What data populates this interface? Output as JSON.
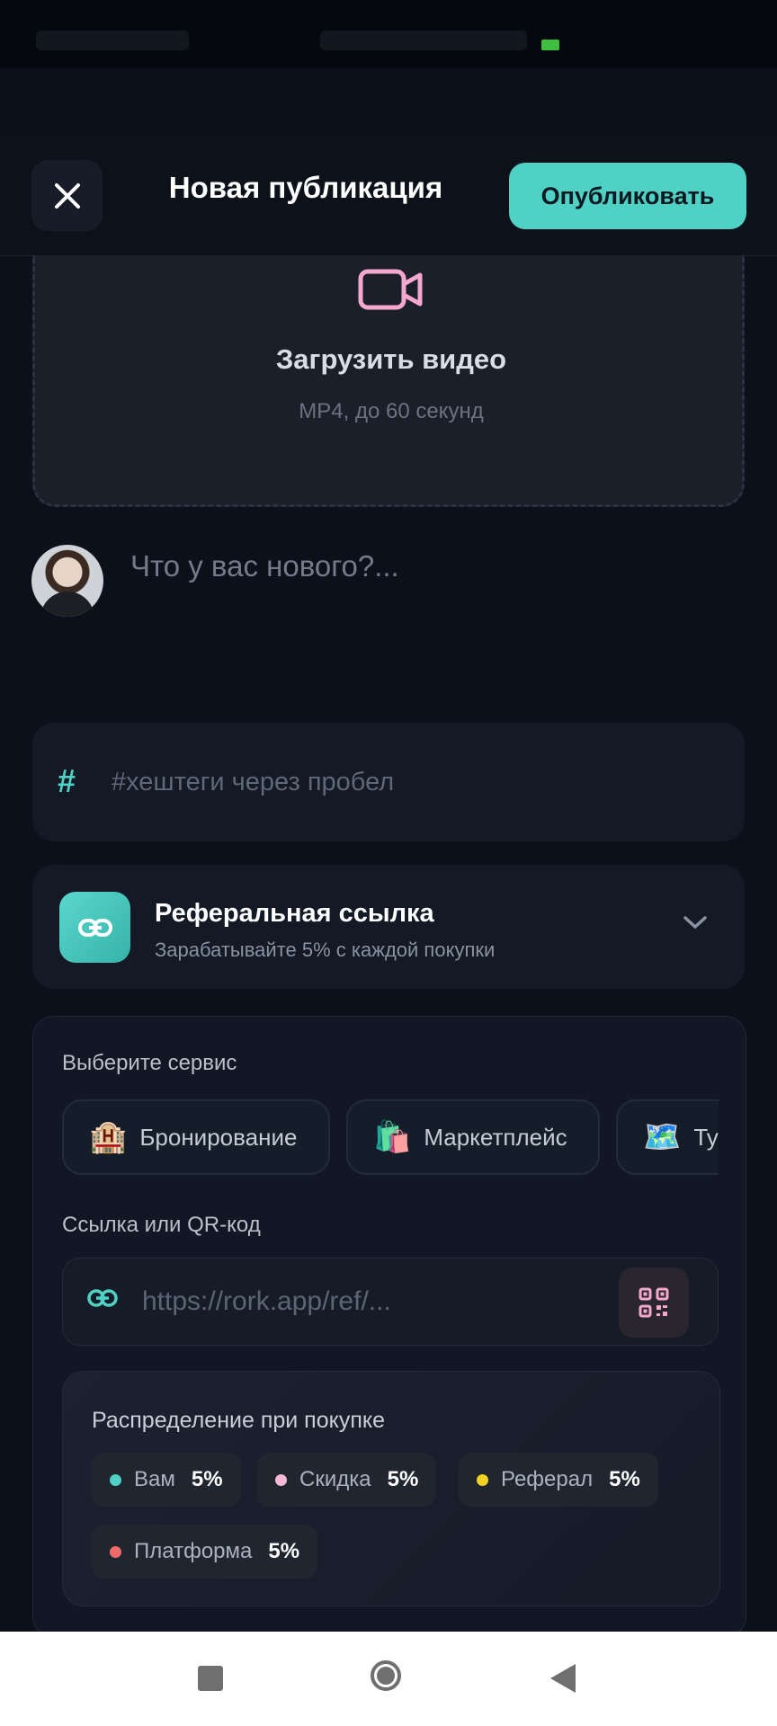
{
  "header": {
    "title": "Новая публикация",
    "publish_label": "Опубликовать",
    "close_icon": "close-icon"
  },
  "upload": {
    "icon": "video-camera-icon",
    "title": "Загрузить видео",
    "subtitle": "MP4, до 60 секунд"
  },
  "post": {
    "placeholder": "Что у вас нового?..."
  },
  "hashtags": {
    "symbol": "#",
    "placeholder": "#хештеги через пробел"
  },
  "referral": {
    "title": "Реферальная ссылка",
    "subtitle": "Зарабатывайте 5% с каждой покупки",
    "icon": "link-icon",
    "chevron": "chevron-down-icon"
  },
  "service": {
    "label": "Выберите сервис",
    "options": [
      {
        "emoji": "🏨",
        "label": "Бронирование"
      },
      {
        "emoji": "🛍️",
        "label": "Маркетплейс"
      },
      {
        "emoji": "🗺️",
        "label": "Ту"
      }
    ],
    "link_label": "Ссылка или QR-код",
    "link_placeholder": "https://rork.app/ref/...",
    "qr_icon": "qr-code-icon"
  },
  "distribution": {
    "title": "Распределение при покупке",
    "items": [
      {
        "label": "Вам",
        "value": "5%",
        "color": "#4fd1c5"
      },
      {
        "label": "Скидка",
        "value": "5%",
        "color": "#f6b8d8"
      },
      {
        "label": "Реферал",
        "value": "5%",
        "color": "#f2d024"
      },
      {
        "label": "Платформа",
        "value": "5%",
        "color": "#f06a6a"
      }
    ]
  },
  "colors": {
    "accent": "#4fd1c5",
    "background": "#0b101a",
    "video_icon": "#f4a8cf"
  }
}
